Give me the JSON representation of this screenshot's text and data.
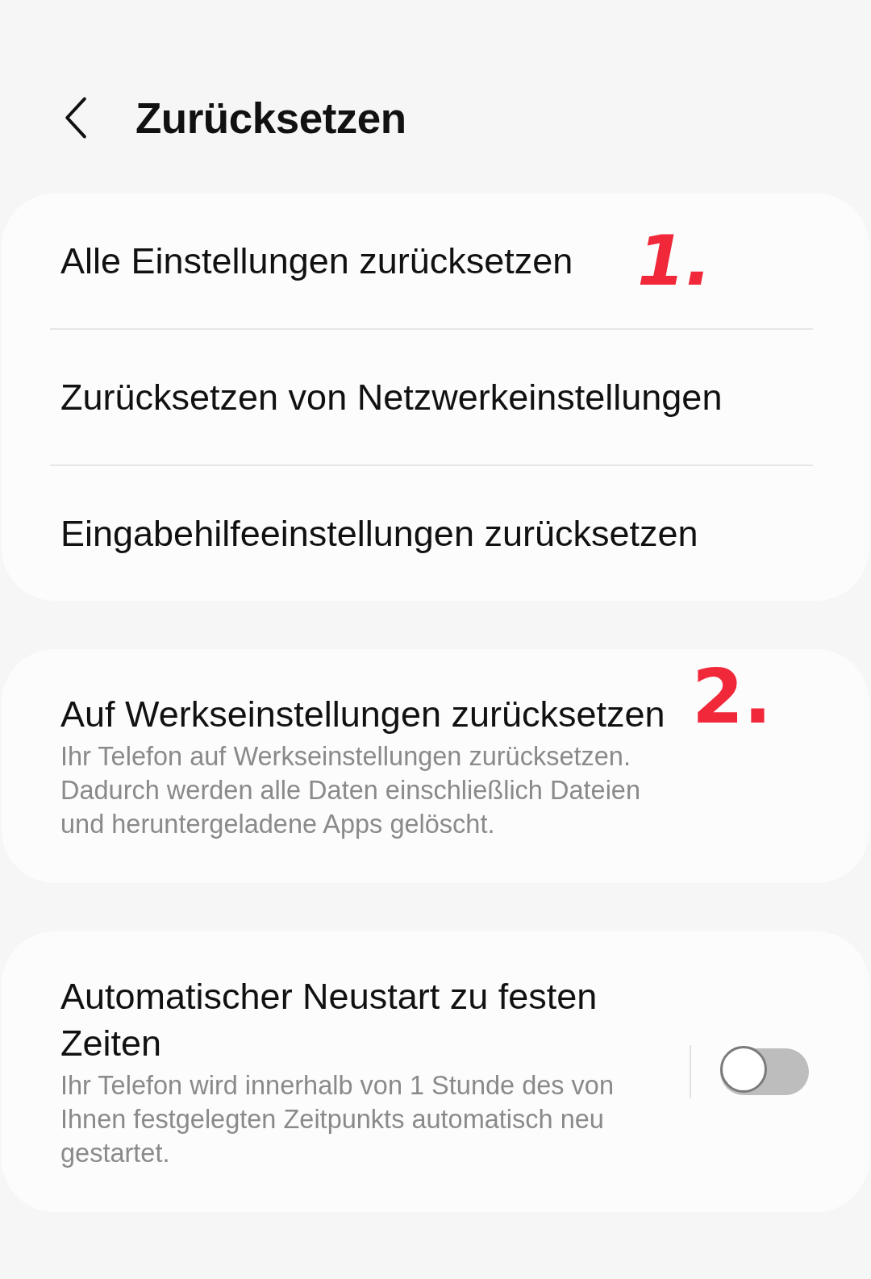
{
  "header": {
    "title": "Zurücksetzen"
  },
  "groups": [
    {
      "items": [
        {
          "title": "Alle Einstellungen zurücksetzen",
          "annotation": "1."
        },
        {
          "title": "Zurücksetzen von Netzwerkeinstellungen"
        },
        {
          "title": "Eingabehilfeeinstellungen zurücksetzen"
        }
      ]
    },
    {
      "items": [
        {
          "title": "Auf Werkseinstellungen zurücksetzen",
          "subtitle": "Ihr Telefon auf Werkseinstellungen zurücksetzen. Dadurch werden alle Daten einschließlich Dateien und heruntergeladene Apps gelöscht.",
          "annotation": "2."
        }
      ]
    },
    {
      "items": [
        {
          "title": "Automatischer Neustart zu festen Zeiten",
          "subtitle": "Ihr Telefon wird innerhalb von 1 Stunde des von Ihnen festgelegten Zeitpunkts automatisch neu gestartet.",
          "kind": "toggle",
          "on": false
        }
      ]
    }
  ]
}
